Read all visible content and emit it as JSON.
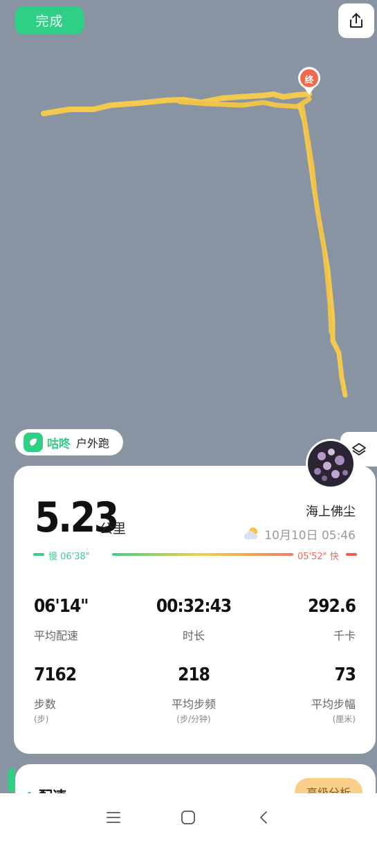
{
  "header": {
    "done_label": "完成",
    "share_icon": "share-icon"
  },
  "map": {
    "end_marker_label": "终",
    "route_color": "#f3c94e",
    "background_color": "#8994a3"
  },
  "app": {
    "name": "咕咚",
    "mode": "户外跑"
  },
  "summary": {
    "distance": "5.23",
    "distance_unit": "公里",
    "username": "海上佛尘",
    "weather_icon": "partly-cloudy-icon",
    "date_time": "10月10日 05:46",
    "pace_slow_label": "慢 06'38\"",
    "pace_fast_label": "05'52\" 快"
  },
  "stats": {
    "avg_pace": {
      "value": "06'14\"",
      "label": "平均配速"
    },
    "duration": {
      "value": "00:32:43",
      "label": "时长"
    },
    "calories": {
      "value": "292.6",
      "label": "千卡"
    },
    "steps": {
      "value": "7162",
      "label": "步数",
      "unit": "(步)"
    },
    "cadence": {
      "value": "218",
      "label": "平均步频",
      "unit": "(步/分钟)"
    },
    "stride": {
      "value": "73",
      "label": "平均步幅",
      "unit": "(厘米)"
    }
  },
  "pace_section": {
    "title": "配速",
    "advanced_button": "高级分析"
  },
  "nav": {
    "menu_icon": "menu-icon",
    "home_icon": "home-icon",
    "back_icon": "back-icon"
  },
  "colors": {
    "accent": "#2fcf86",
    "pace_slow": "#37cf8b",
    "pace_fast": "#ee6a5e"
  }
}
